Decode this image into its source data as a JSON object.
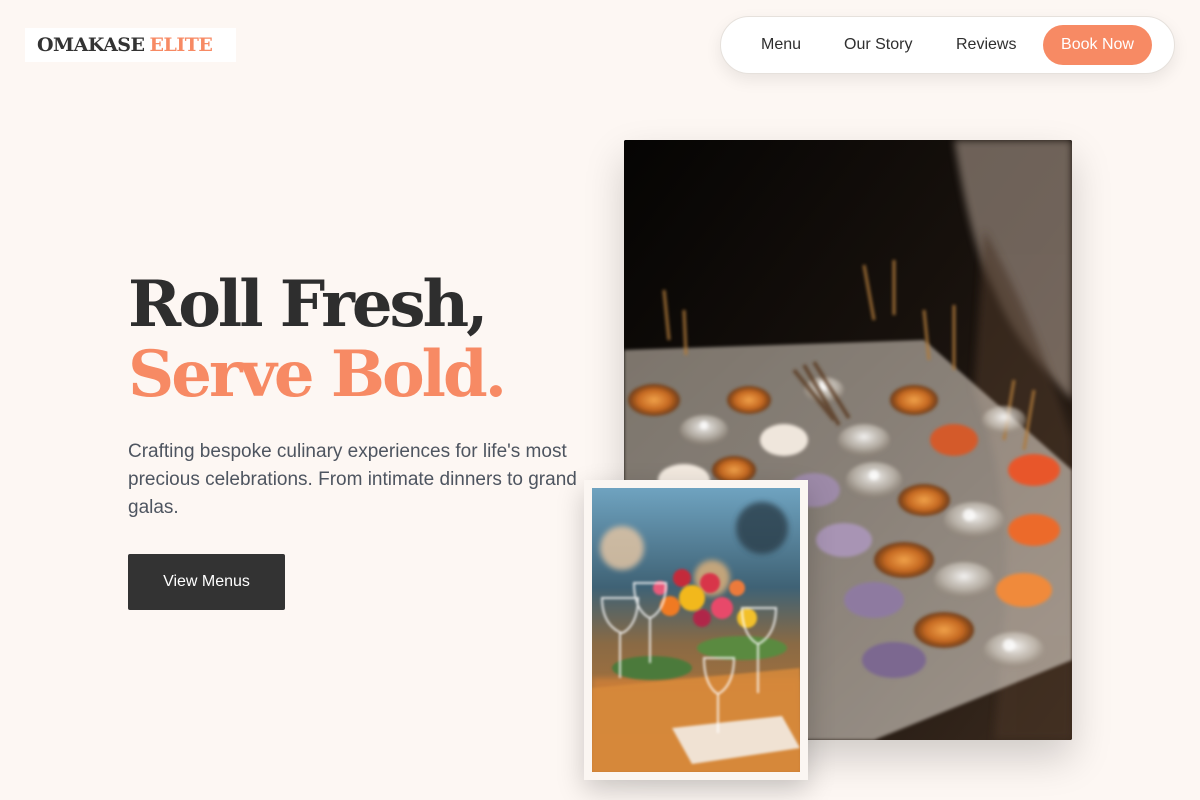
{
  "brand": {
    "logo_part1": "OMAKASE",
    "logo_part2": "ELITE",
    "accent_color": "#f78a64",
    "dark_color": "#333333"
  },
  "nav": {
    "items": [
      {
        "label": "Menu"
      },
      {
        "label": "Our Story"
      },
      {
        "label": "Reviews"
      }
    ],
    "cta_label": "Book Now"
  },
  "hero": {
    "headline_line1": "Roll Fresh,",
    "headline_line2": "Serve Bold.",
    "description": "Crafting bespoke culinary experiences for life's most precious celebrations. From intimate dinners to grand galas.",
    "button_label": "View Menus"
  },
  "images": {
    "main_photo": "catering-desserts-photo",
    "secondary_photo": "table-floral-setting-photo"
  }
}
